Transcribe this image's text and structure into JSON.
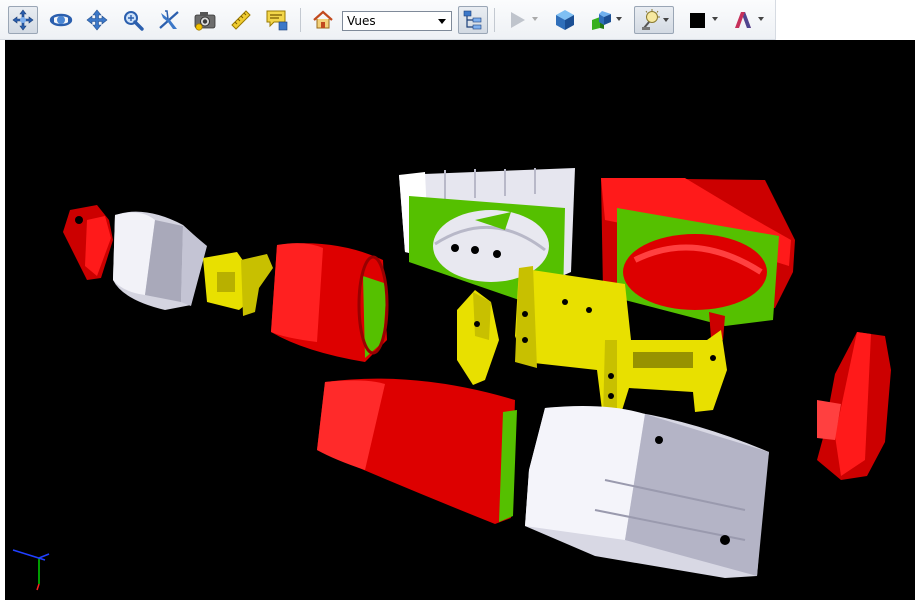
{
  "toolbar": {
    "views_value": "Vues"
  },
  "colors": {
    "viewport_bg": "#000000",
    "part_red": "#e00000",
    "part_white": "#d8d8e4",
    "part_yellow": "#e8e000",
    "part_green": "#55c000",
    "toolbar_bg": "#eef1f5"
  },
  "icons": [
    "navigate-icon",
    "rotate-icon",
    "pan-icon",
    "zoom-icon",
    "fly-icon",
    "camera-icon",
    "measure-icon",
    "comment-icon",
    "home-icon",
    "tree-icon",
    "play-icon",
    "cube-icon",
    "render-mode-icon",
    "lighting-icon",
    "background-color-icon",
    "shading-icon"
  ]
}
